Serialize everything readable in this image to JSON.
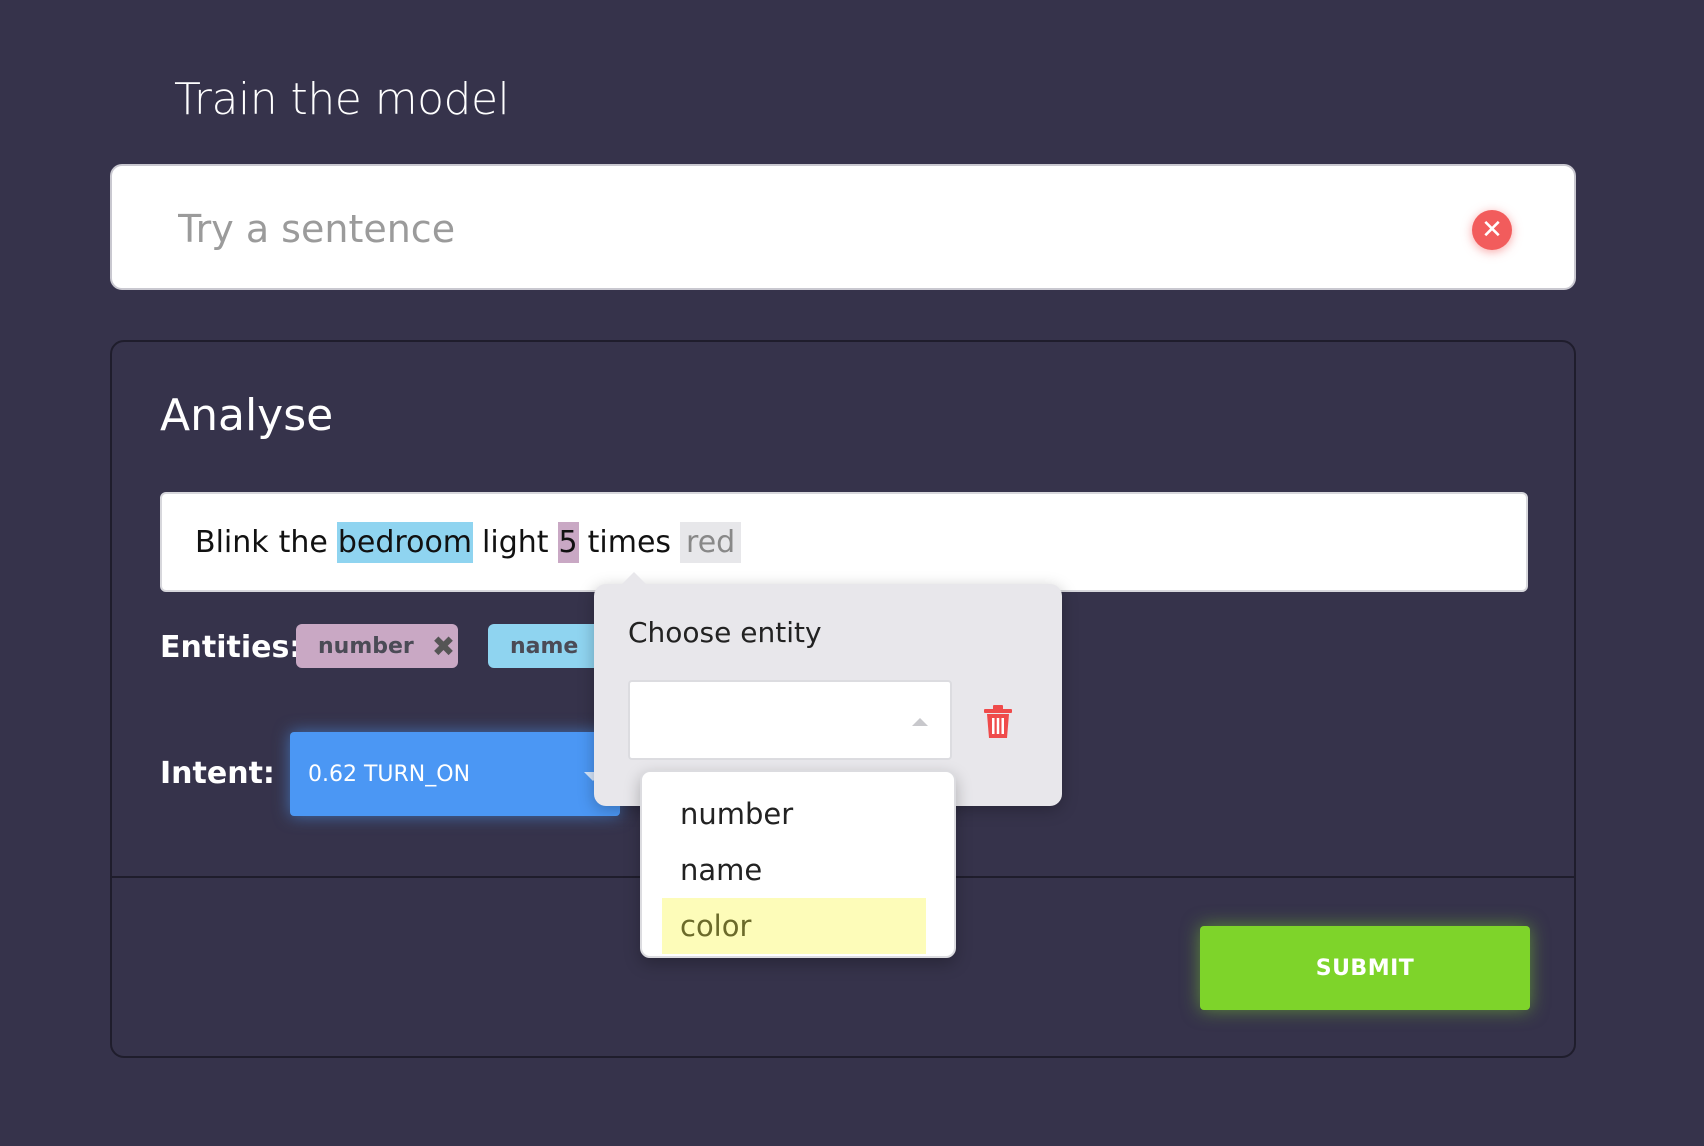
{
  "page": {
    "title": "Train the model"
  },
  "sentence_input": {
    "placeholder": "Try a sentence",
    "value": "",
    "clear_icon": "close-circle-icon"
  },
  "analyse": {
    "title": "Analyse",
    "tokens": [
      {
        "text": "Blink",
        "entity": null
      },
      {
        "text": "the",
        "entity": null
      },
      {
        "text": "bedroom",
        "entity": "name"
      },
      {
        "text": "light",
        "entity": null
      },
      {
        "text": "5",
        "entity": "number"
      },
      {
        "text": "times",
        "entity": null
      },
      {
        "text": "red",
        "entity": "selected"
      }
    ],
    "entities_label": "Entities:",
    "entities": [
      {
        "label": "number",
        "color": "#c9a8c4",
        "remove_icon": "close-icon"
      },
      {
        "label": "name",
        "color": "#8fd4f0"
      }
    ],
    "intent_label": "Intent:",
    "intent": {
      "value": "0.62 TURN_ON",
      "color": "#4b97f4"
    },
    "submit_label": "SUBMIT",
    "submit_color": "#7ed42a"
  },
  "entity_popover": {
    "title": "Choose entity",
    "select_value": "",
    "delete_icon": "trash-icon",
    "options": [
      "number",
      "name",
      "color"
    ],
    "highlighted_option": "color"
  }
}
